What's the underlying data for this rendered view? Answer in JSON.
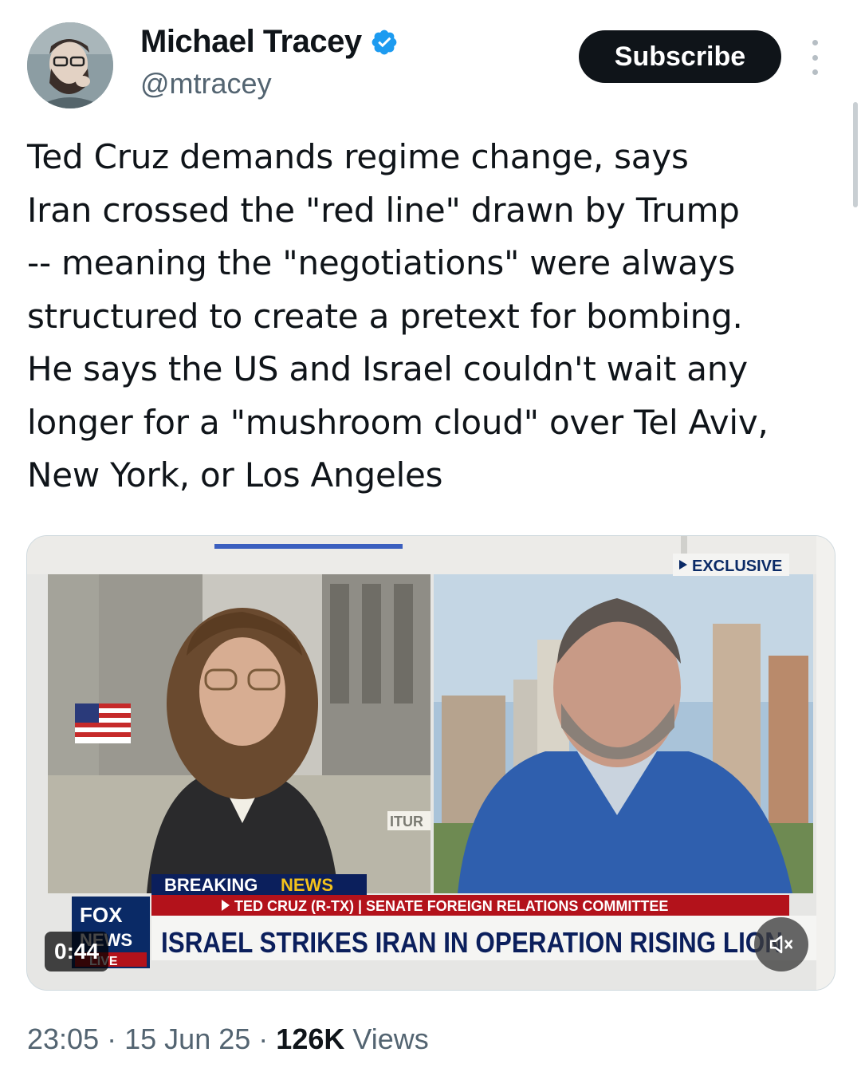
{
  "author": {
    "display_name": "Michael Tracey",
    "handle": "@mtracey",
    "verified": true
  },
  "subscribe_label": "Subscribe",
  "tweet": {
    "text": "Ted Cruz demands regime change, says\nIran crossed the \"red line\" drawn by Trump\n-- meaning the \"negotiations\" were always\nstructured to create a pretext for bombing.\nHe says the US and Israel couldn't wait any\nlonger for a \"mushroom cloud\" over Tel Aviv,\nNew York, or Los Angeles"
  },
  "video": {
    "exclusive_tag": "EXCLUSIVE",
    "breaking": "BREAKING",
    "news": "NEWS",
    "subtitle": "TED CRUZ (R-TX) | SENATE FOREIGN RELATIONS COMMITTEE",
    "headline": "ISRAEL STRIKES IRAN IN OPERATION RISING LION",
    "network_logo_top": "FOX",
    "network_logo_mid": "NEWS",
    "network_logo_live": "LIVE",
    "background_sign": "ITUR",
    "timestamp": "0:44",
    "muted": true
  },
  "footer": {
    "time": "23:05",
    "date": "15 Jun 25",
    "views_count": "126K",
    "views_label": "Views",
    "separator": "·"
  },
  "colors": {
    "accent_blue": "#1d9bf0",
    "fox_red": "#b3121b",
    "fox_navy": "#0a2a66"
  }
}
